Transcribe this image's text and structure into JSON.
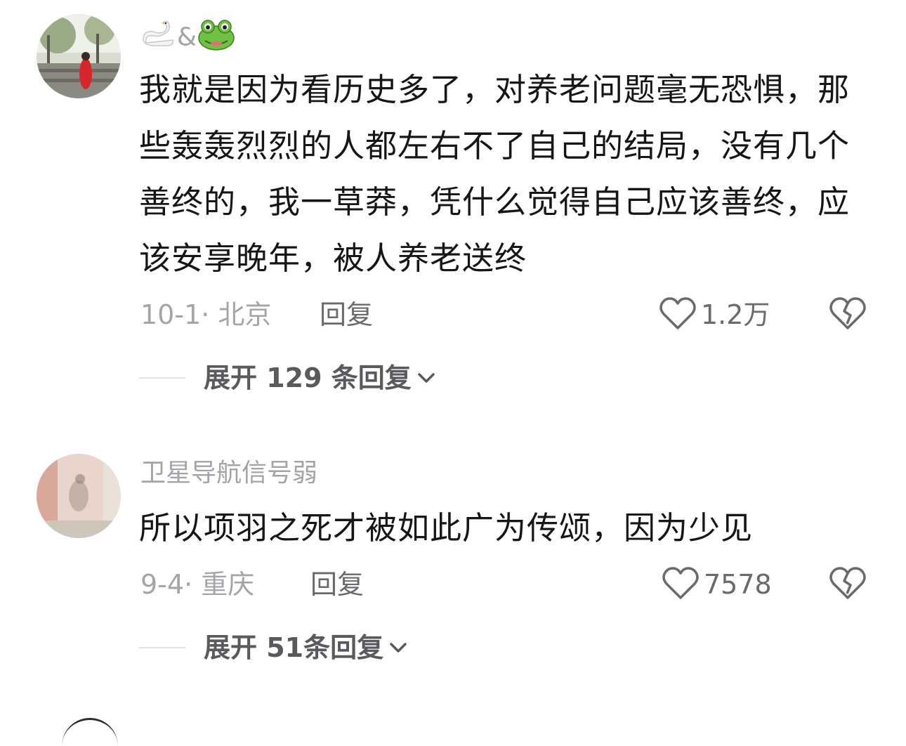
{
  "comments": [
    {
      "username": "&",
      "username_emoji": [
        "swan-icon",
        "frog-icon"
      ],
      "text": "我就是因为看历史多了，对养老问题毫无恐惧，那些轰轰烈烈的人都左右不了自己的结局，没有几个善终的，我一草莽，凭什么觉得自己应该善终，应该安享晚年，被人养老送终",
      "date_location": "10-1· 北京",
      "reply_label": "回复",
      "likes": "1.2万",
      "expand_label": "展开 129 条回复"
    },
    {
      "username": "卫星导航信号弱",
      "text": "所以项羽之死才被如此广为传颂，因为少见",
      "date_location": "9-4· 重庆",
      "reply_label": "回复",
      "likes": "7578",
      "expand_label": "展开 51条回复"
    }
  ],
  "colors": {
    "meta_gray": "#a5a5a9",
    "action_gray": "#6a6a6e",
    "text_dark": "#161616",
    "background": "#ffffff"
  }
}
